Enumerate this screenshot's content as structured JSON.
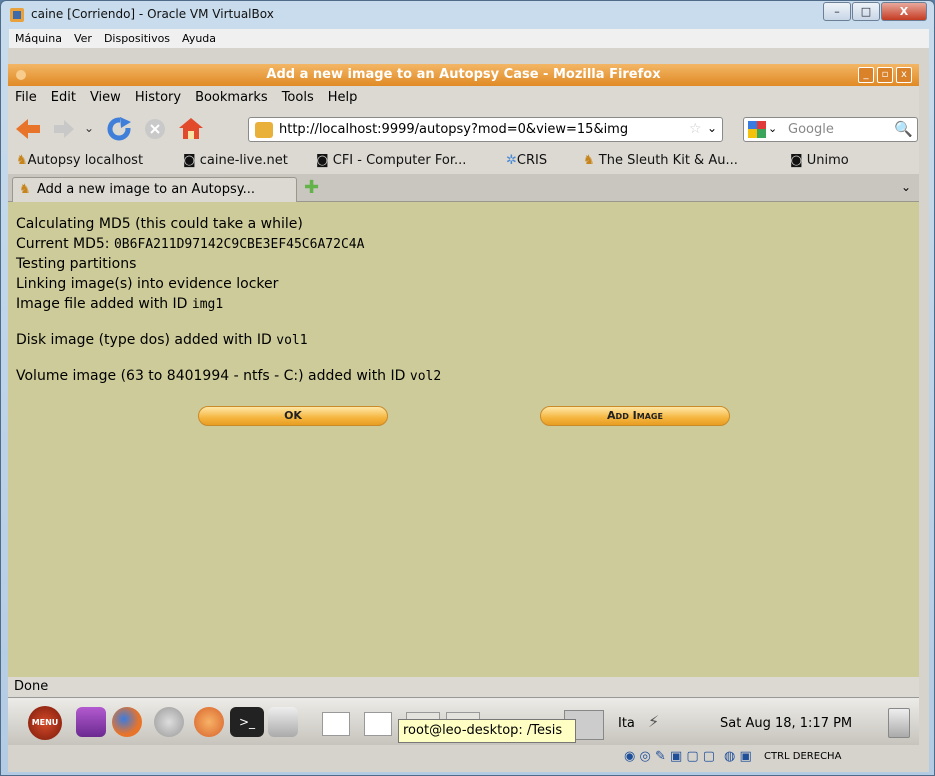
{
  "vbox": {
    "title": "caine [Corriendo] - Oracle VM VirtualBox",
    "menu": [
      "Máquina",
      "Ver",
      "Dispositivos",
      "Ayuda"
    ],
    "controls": {
      "minimize": "–",
      "maximize": "□",
      "close": "X"
    }
  },
  "firefox": {
    "title": "Add a new image to an Autopsy Case - Mozilla Firefox",
    "menu": [
      "File",
      "Edit",
      "View",
      "History",
      "Bookmarks",
      "Tools",
      "Help"
    ],
    "url": "http://localhost:9999/autopsy?mod=0&view=15&img",
    "search_placeholder": "Google",
    "bookmarks": [
      "Autopsy localhost",
      "caine-live.net",
      "CFI - Computer For...",
      "CRIS",
      "The Sleuth Kit & Au...",
      "Unimo"
    ],
    "tab_label": "Add a new image to an Autopsy...",
    "status": "Done"
  },
  "content": {
    "line1": "Calculating MD5 (this could take a while)",
    "md5_label": "Current MD5: ",
    "md5_value": "0B6FA211D97142C9CBE3EF45C6A72C4A",
    "line3": "Testing partitions",
    "line4": "Linking image(s) into evidence locker",
    "line5_text": "Image file added with ID ",
    "line5_id": "img1",
    "line6_text": "Disk image (type dos) added with ID ",
    "line6_id": "vol1",
    "line7_text": "Volume image (63 to 8401994 - ntfs - C:) added with ID ",
    "line7_id": "vol2",
    "ok_button": "OK",
    "add_image_button": "Add Image"
  },
  "taskbar": {
    "menu_label": "MENU",
    "tooltip": "root@leo-desktop: /Tesis",
    "keyboard": "Ita",
    "clock": "Sat Aug 18,  1:17 PM",
    "host_key": "CTRL DERECHA"
  }
}
